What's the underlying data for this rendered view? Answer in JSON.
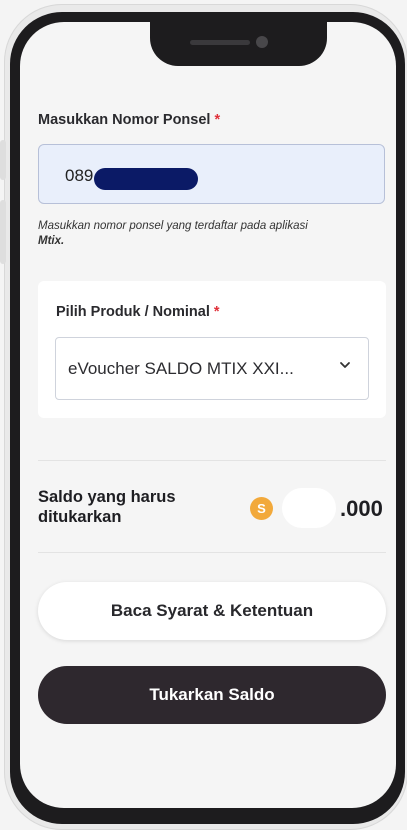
{
  "form": {
    "phone_label": "Masukkan Nomor Ponsel",
    "required_mark": "*",
    "phone_value": "089",
    "helper_text": "Masukkan nomor ponsel yang terdaftar pada aplikasi",
    "helper_app": "Mtix.",
    "product_label": "Pilih Produk / Nominal",
    "product_selected": "eVoucher SALDO MTIX XXI..."
  },
  "balance": {
    "label": "Saldo yang harus ditukarkan",
    "coin_symbol": "S",
    "amount_suffix": ".000"
  },
  "actions": {
    "terms_label": "Baca Syarat & Ketentuan",
    "redeem_label": "Tukarkan Saldo"
  },
  "colors": {
    "redeem_button": "#2e282e",
    "coin": "#f2a93b",
    "required": "#e0303a",
    "input_bg": "#e9effb"
  }
}
